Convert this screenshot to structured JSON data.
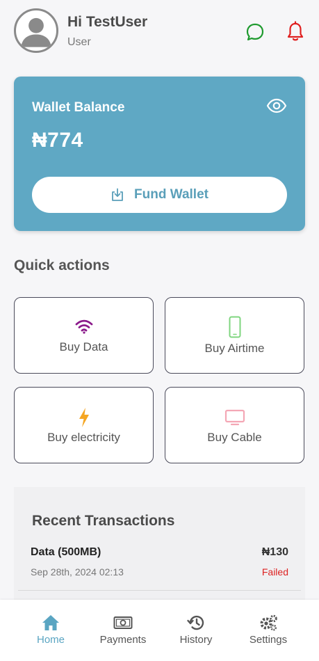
{
  "header": {
    "greeting": "Hi TestUser",
    "role": "User",
    "icons": [
      "avatar-icon",
      "chat-icon",
      "bell-icon"
    ]
  },
  "wallet": {
    "title": "Wallet Balance",
    "amount": "₦774",
    "fund_label": "Fund Wallet",
    "color": "#5fa8c4"
  },
  "quick_actions": {
    "title": "Quick actions",
    "items": [
      {
        "label": "Buy Data",
        "icon": "wifi-icon",
        "color": "#8b1a8b"
      },
      {
        "label": "Buy Airtime",
        "icon": "phone-icon",
        "color": "#7fd67f"
      },
      {
        "label": "Buy electricity",
        "icon": "bolt-icon",
        "color": "#f5a623"
      },
      {
        "label": "Buy Cable",
        "icon": "tv-icon",
        "color": "#f4a7b5"
      }
    ]
  },
  "recent": {
    "title": "Recent Transactions",
    "transactions": [
      {
        "name": "Data (500MB)",
        "amount": "₦130",
        "date": "Sep 28th, 2024 02:13",
        "status": "Failed"
      }
    ]
  },
  "nav": {
    "items": [
      {
        "label": "Home",
        "icon": "home-icon"
      },
      {
        "label": "Payments",
        "icon": "payments-icon"
      },
      {
        "label": "History",
        "icon": "history-icon"
      },
      {
        "label": "Settings",
        "icon": "settings-icon"
      }
    ],
    "active": "Home",
    "active_color": "#5aa5c2"
  }
}
